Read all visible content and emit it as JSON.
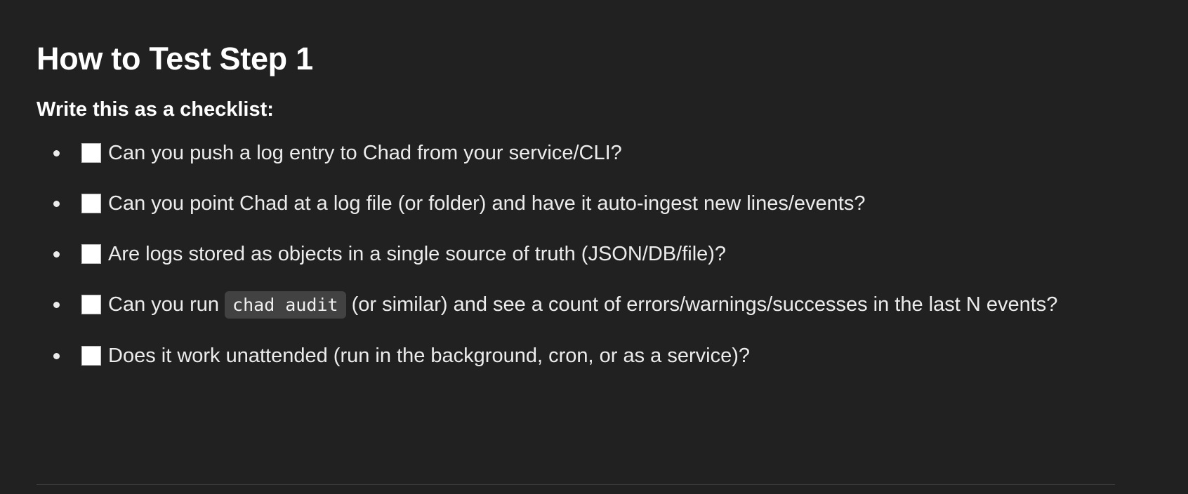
{
  "heading": "How to Test Step 1",
  "intro": "Write this as a checklist:",
  "checklist": [
    {
      "text": "Can you push a log entry to Chad from your service/CLI?",
      "checked": false
    },
    {
      "text": "Can you point Chad at a log file (or folder) and have it auto-ingest new lines/events?",
      "checked": false
    },
    {
      "text": "Are logs stored as objects in a single source of truth (JSON/DB/file)?",
      "checked": false
    },
    {
      "text_before": "Can you run ",
      "code": "chad audit",
      "text_after": " (or similar) and see a count of errors/warnings/successes in the last N events?",
      "checked": false
    },
    {
      "text": "Does it work unattended (run in the background, cron, or as a service)?",
      "checked": false
    }
  ]
}
